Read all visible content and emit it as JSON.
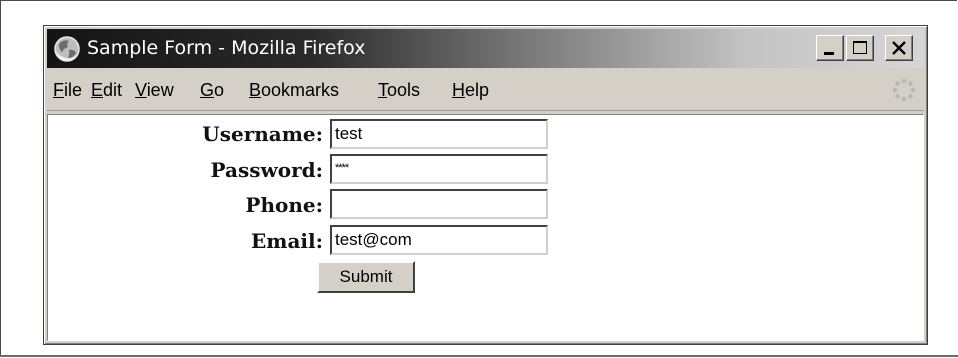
{
  "window": {
    "title": "Sample Form - Mozilla Firefox"
  },
  "menu": {
    "items": [
      "File",
      "Edit",
      "View",
      "Go",
      "Bookmarks",
      "Tools",
      "Help"
    ]
  },
  "form": {
    "fields": [
      {
        "label": "Username:",
        "value": "test"
      },
      {
        "label": "Password:",
        "value": "****"
      },
      {
        "label": "Phone:",
        "value": ""
      },
      {
        "label": "Email:",
        "value": "test@com"
      }
    ],
    "submit_label": "Submit"
  },
  "icons": {
    "app": "firefox-globe-icon",
    "minimize": "minimize-icon",
    "maximize": "maximize-icon",
    "close": "close-icon",
    "throbber": "throbber-icon"
  }
}
